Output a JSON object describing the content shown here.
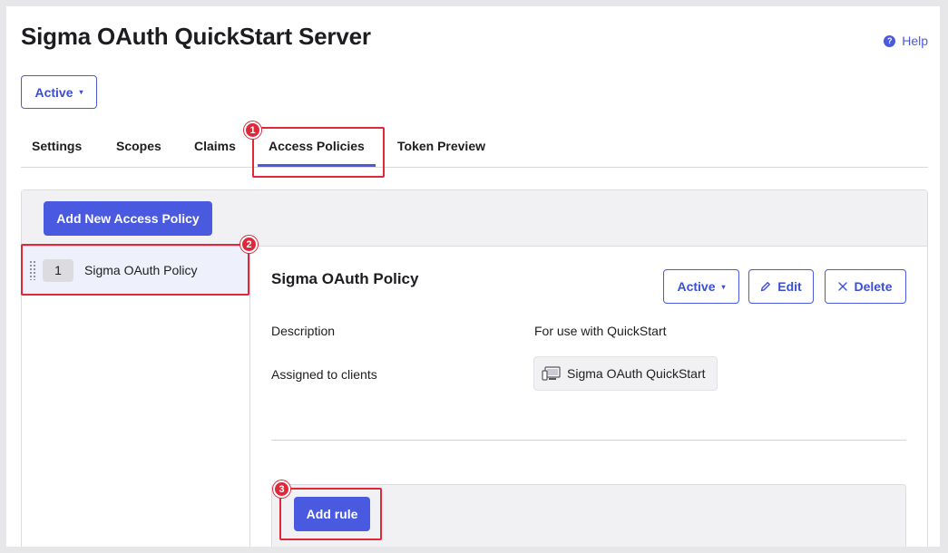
{
  "page": {
    "title": "Sigma OAuth QuickStart Server",
    "help_label": "Help",
    "help_icon": "question-circle-icon"
  },
  "server_status": {
    "label": "Active",
    "caret": "▾"
  },
  "tabs": [
    {
      "label": "Settings"
    },
    {
      "label": "Scopes"
    },
    {
      "label": "Claims"
    },
    {
      "label": "Access Policies",
      "active": true
    },
    {
      "label": "Token Preview"
    }
  ],
  "markers": [
    "1",
    "2",
    "3"
  ],
  "add_policy_label": "Add New Access Policy",
  "policy_list": [
    {
      "priority": "1",
      "name": "Sigma OAuth Policy"
    }
  ],
  "policy_detail": {
    "title": "Sigma OAuth Policy",
    "status_label": "Active",
    "edit_label": "Edit",
    "delete_label": "Delete",
    "description_label": "Description",
    "description_value": "For use with QuickStart",
    "assigned_label": "Assigned to clients",
    "assigned_client": "Sigma OAuth QuickStart",
    "add_rule_label": "Add rule"
  },
  "colors": {
    "accent": "#4a5ae0",
    "highlight": "#e0283a",
    "panel_bg": "#f1f1f3"
  }
}
